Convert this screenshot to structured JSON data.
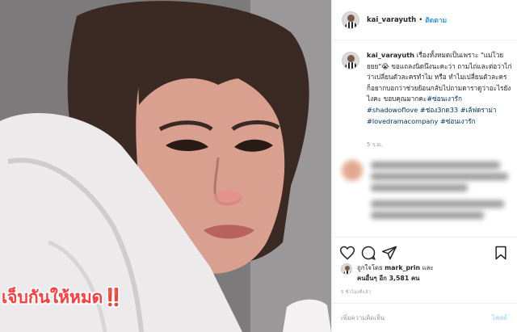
{
  "photo": {
    "overlay_caption": "เจ็บกันให้หมด‼️"
  },
  "header": {
    "username": "kai_varayuth",
    "separator": "•",
    "follow_label": "ติดตาม"
  },
  "caption": {
    "username": "kai_varayuth",
    "text": "เรื่องทั้งหมดเป็นเพราะ \"แม่โวยยยย\"😭 ขอแถลงนิดนึงนะคะว่า ถามไถ่และต่อว่าไก่ ว่าเปลี่ยนตัวละครทำไม หรือ ทำไมเปลี่ยนตัวละคร ก็อยากบอกว่าช่วยย้อนกลับไปถามดาราดูว่าอะไรยังไงคะ ขอบคุณมากคะ",
    "hashtags": [
      "#ซ่อนเงารัก",
      "#shadowoflove",
      "#ช่อง3กด33",
      "#เล้ฟดราม่า",
      "#lovedramacompany",
      "#ซ่อนเงารัก"
    ],
    "time": "5 ร.ม."
  },
  "actions": {
    "like_icon": "heart-icon",
    "comment_icon": "comment-bubble-icon",
    "share_icon": "share-arrow-icon",
    "save_icon": "bookmark-icon"
  },
  "likes": {
    "prefix": "ถูกใจโดย",
    "first_user": "mark_prin",
    "and": "และ",
    "others": "คนอื่นๆ อีก 3,581 คน"
  },
  "post_time": "5 ชั่วโมงที่แล้ว",
  "add_comment": {
    "placeholder": "เพิ่มความคิดเห็น",
    "post_label": "โพสต์"
  },
  "colors": {
    "link": "#3897f0",
    "hashtag": "#003569",
    "overlay_text": "#ff3b3b"
  }
}
